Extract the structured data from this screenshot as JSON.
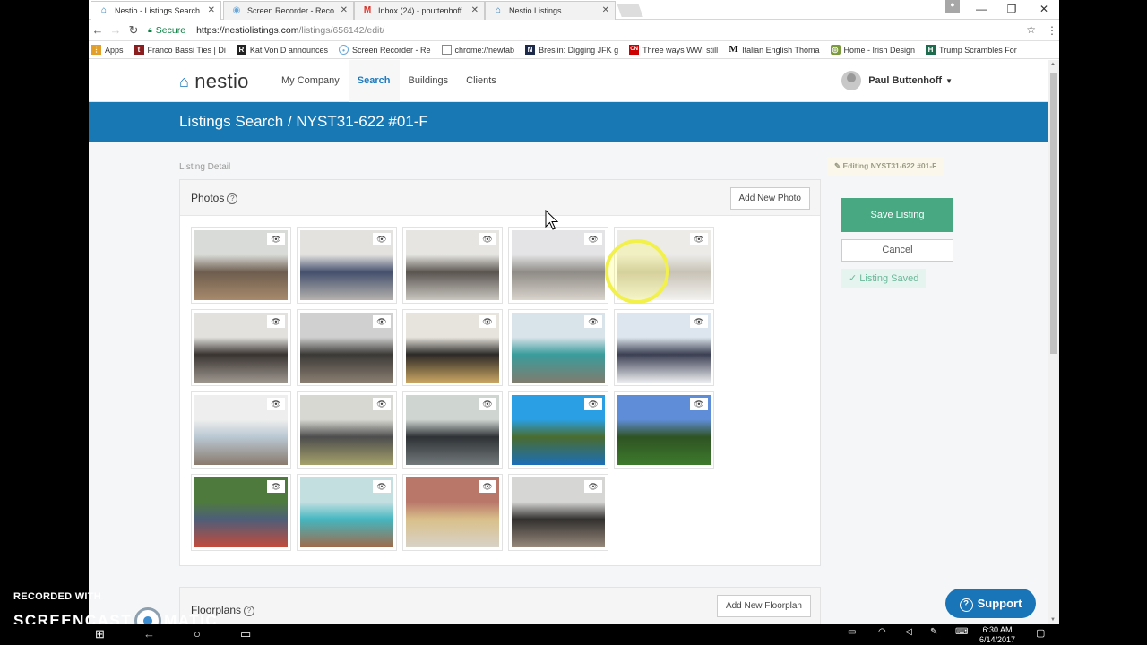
{
  "browser": {
    "tabs": [
      {
        "title": "Nestio - Listings Search",
        "icon": "house-icon",
        "active": true
      },
      {
        "title": "Screen Recorder - Reco",
        "icon": "record-icon",
        "active": false
      },
      {
        "title": "Inbox (24) - pbuttenhoff",
        "icon": "gmail-icon",
        "active": false
      },
      {
        "title": "Nestio Listings",
        "icon": "house-icon",
        "active": false
      }
    ],
    "secure_label": "Secure",
    "url_domain": "https://nestiolistings.com",
    "url_path": "/listings/656142/edit/",
    "bookmarks": [
      {
        "label": "Apps",
        "icon": "apps-icon",
        "color": "#e2a02b"
      },
      {
        "label": "Franco Bassi Ties | Di",
        "icon": "tie-icon",
        "color": "#8a1e1e"
      },
      {
        "label": "Kat Von D announces",
        "icon": "r-icon",
        "color": "#222222"
      },
      {
        "label": "Screen Recorder - Re",
        "icon": "record-icon",
        "color": "#6aa7d8"
      },
      {
        "label": "chrome://newtab",
        "icon": "page-icon",
        "color": "#888888"
      },
      {
        "label": "Breslin: Digging JFK g",
        "icon": "n-icon",
        "color": "#1d2a4a"
      },
      {
        "label": "Three ways WWI still",
        "icon": "cnn-icon",
        "color": "#cc0000"
      },
      {
        "label": "Italian English Thoma",
        "icon": "m-icon",
        "color": "#111111"
      },
      {
        "label": "Home - Irish Design",
        "icon": "irish-design-icon",
        "color": "#7b9a3c"
      },
      {
        "label": "Trump Scrambles For",
        "icon": "h-icon",
        "color": "#1f6b4e"
      }
    ]
  },
  "app": {
    "logo": "nestio",
    "nav": [
      {
        "label": "My Company",
        "active": false
      },
      {
        "label": "Search",
        "active": true
      },
      {
        "label": "Buildings",
        "active": false
      },
      {
        "label": "Clients",
        "active": false
      }
    ],
    "user_name": "Paul Buttenhoff",
    "banner_title": "Listings Search / NYST31-622 #01-F",
    "breadcrumb": "Listing Detail",
    "photos_panel": {
      "title": "Photos",
      "add_button": "Add New Photo",
      "photos": [
        {
          "desc": "living room with dining table and pendant light",
          "colors": [
            "#d9dbd8",
            "#6e5d4e",
            "#a88a6c"
          ]
        },
        {
          "desc": "living room with blue sectional sofa",
          "colors": [
            "#e3e2df",
            "#44506d",
            "#b5b2ad"
          ]
        },
        {
          "desc": "kitchen with stainless appliances",
          "colors": [
            "#e6e5e1",
            "#5b5550",
            "#c9c6c0"
          ]
        },
        {
          "desc": "bedroom with window",
          "colors": [
            "#e4e4e6",
            "#8f8b86",
            "#d9d4cc"
          ]
        },
        {
          "desc": "bathroom vanity",
          "colors": [
            "#ecebe8",
            "#c8c2b6",
            "#f3f2f0"
          ]
        },
        {
          "desc": "bathroom with mirror",
          "colors": [
            "#e2e1de",
            "#3a3431",
            "#9d968f"
          ]
        },
        {
          "desc": "living room with TV",
          "colors": [
            "#cfd0cf",
            "#3b3936",
            "#8a7e71"
          ]
        },
        {
          "desc": "dining area with pendant lamp",
          "colors": [
            "#e7e4dd",
            "#2c2a27",
            "#c8a562"
          ]
        },
        {
          "desc": "study with teal desk",
          "colors": [
            "#d9e3ea",
            "#3a9c9c",
            "#7f7d6f"
          ]
        },
        {
          "desc": "kitchen with gas range",
          "colors": [
            "#dde6ee",
            "#3b3f52",
            "#eaecef"
          ]
        },
        {
          "desc": "bright bedroom",
          "colors": [
            "#eeeeee",
            "#b9c8d3",
            "#8a7a6c"
          ]
        },
        {
          "desc": "fitness center",
          "colors": [
            "#d8d8d2",
            "#4d4d4d",
            "#a6a26b"
          ]
        },
        {
          "desc": "cardio room with bikes",
          "colors": [
            "#cfd6d2",
            "#2e3235",
            "#737a7c"
          ]
        },
        {
          "desc": "kids pool with slide",
          "colors": [
            "#2a9fe3",
            "#4a6c2f",
            "#1c6fb8"
          ]
        },
        {
          "desc": "park lawn at dusk",
          "colors": [
            "#5f8dd8",
            "#2e5323",
            "#3e7a2c"
          ]
        },
        {
          "desc": "basketball court with players",
          "colors": [
            "#4f7a3e",
            "#4d5e7a",
            "#c44b3b"
          ]
        },
        {
          "desc": "building lobby with teal columns",
          "colors": [
            "#c3dfe0",
            "#44b6c0",
            "#a06a4a"
          ]
        },
        {
          "desc": "courtyard with yellow tables",
          "colors": [
            "#b9776a",
            "#d9c08a",
            "#d8d2c8"
          ]
        },
        {
          "desc": "lounge with TV",
          "colors": [
            "#d6d6d4",
            "#32302e",
            "#98897c"
          ]
        }
      ]
    },
    "floorplans_panel": {
      "title": "Floorplans",
      "add_button": "Add New Floorplan"
    },
    "sidebar": {
      "editing_label": "Editing NYST31-622 #01-F",
      "save_button": "Save Listing",
      "cancel_button": "Cancel",
      "saved_status": "Listing Saved"
    },
    "support_button": "Support"
  },
  "overlay": {
    "watermark_line1": "RECORDED WITH",
    "watermark_line2a": "SCREENCAST",
    "watermark_line2b": "MATIC"
  },
  "taskbar": {
    "time": "6:30 AM",
    "date": "6/14/2017"
  }
}
